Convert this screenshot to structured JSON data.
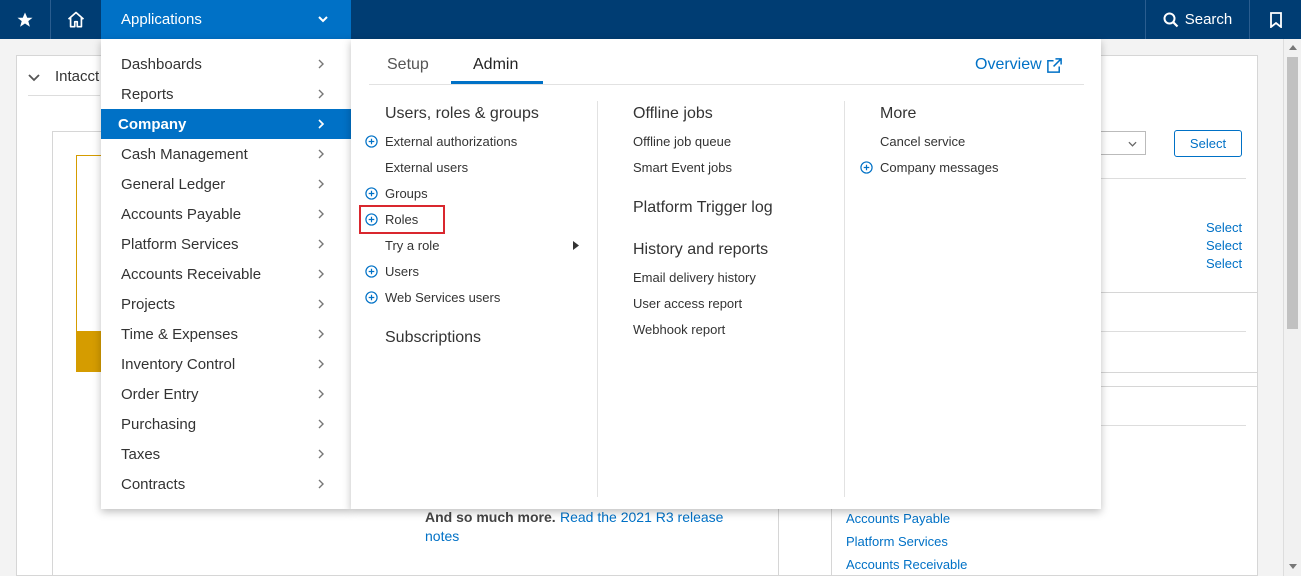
{
  "topbar": {
    "apps_label": "Applications",
    "search_label": "Search",
    "icons": {
      "favorites": "star-icon",
      "home": "home-icon",
      "apps_toggle": "chevron-down-icon",
      "search": "search-icon",
      "bookmark": "bookmark-icon"
    }
  },
  "background": {
    "title": "Intacct",
    "select_button": "Select",
    "select_links": [
      "Select",
      "Select",
      "Select"
    ],
    "release_bold": "And so much more.",
    "release_link_1": "Read the 2021 R3 release",
    "release_link_2": "notes",
    "app_links": [
      "Accounts Payable",
      "Platform Services",
      "Accounts Receivable"
    ]
  },
  "sidebar": {
    "active_index": 2,
    "items": [
      {
        "label": "Dashboards"
      },
      {
        "label": "Reports"
      },
      {
        "label": "Company"
      },
      {
        "label": "Cash Management"
      },
      {
        "label": "General Ledger"
      },
      {
        "label": "Accounts Payable"
      },
      {
        "label": "Platform Services"
      },
      {
        "label": "Accounts Receivable"
      },
      {
        "label": "Projects"
      },
      {
        "label": "Time & Expenses"
      },
      {
        "label": "Inventory Control"
      },
      {
        "label": "Order Entry"
      },
      {
        "label": "Purchasing"
      },
      {
        "label": "Taxes"
      },
      {
        "label": "Contracts"
      }
    ]
  },
  "menu": {
    "tabs": [
      {
        "label": "Setup"
      },
      {
        "label": "Admin"
      }
    ],
    "active_tab": "Admin",
    "overview_label": "Overview",
    "col1": {
      "heading": "Users, roles & groups",
      "items": [
        {
          "label": "External authorizations",
          "has_add": true
        },
        {
          "label": "External users",
          "has_add": false
        },
        {
          "label": "Groups",
          "has_add": true
        },
        {
          "label": "Roles",
          "has_add": true,
          "highlighted": true
        },
        {
          "label": "Try a role",
          "has_add": false,
          "has_submenu": true
        },
        {
          "label": "Users",
          "has_add": true
        },
        {
          "label": "Web Services users",
          "has_add": true
        }
      ],
      "heading2": "Subscriptions"
    },
    "col2": {
      "heading": "Offline jobs",
      "items": [
        {
          "label": "Offline job queue"
        },
        {
          "label": "Smart Event jobs"
        }
      ],
      "heading2": "Platform Trigger log",
      "heading3": "History and reports",
      "items3": [
        {
          "label": "Email delivery history"
        },
        {
          "label": "User access report"
        },
        {
          "label": "Webhook report"
        }
      ]
    },
    "col3": {
      "heading": "More",
      "items": [
        {
          "label": "Cancel service",
          "has_add": false
        },
        {
          "label": "Company messages",
          "has_add": true
        }
      ]
    }
  },
  "colors": {
    "nav": "#003d73",
    "accent": "#0071c6",
    "highlight": "#d9272e",
    "warning": "#d59c00"
  }
}
